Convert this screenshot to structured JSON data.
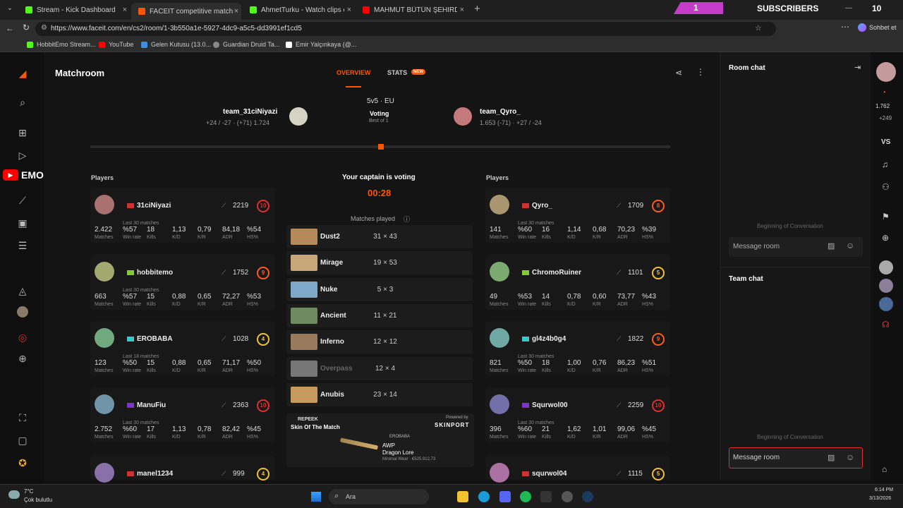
{
  "browser": {
    "tabs": [
      {
        "label": "Stream - Kick Dashboard",
        "color": "#53fc18"
      },
      {
        "label": "FACEIT competitive match - FACEIT",
        "color": "#ff5500"
      },
      {
        "label": "AhmetTurku - Watch clips on Kick",
        "color": "#53fc18"
      },
      {
        "label": "MAHMUT BÜTÜN ŞEHİRDE KAOS",
        "color": "#ff0000"
      }
    ],
    "url": "https://www.faceit.com/en/cs2/room/1-3b550a1e-5927-4dc9-a5c5-dd3991ef1cd5",
    "overlay_subscribers": "SUBSCRIBERS",
    "overlay_count": "1",
    "overlay_right": "10",
    "chat_button": "Sohbet et",
    "bookmarks": [
      "HobbitEmo Stream...",
      "YouTube",
      "Gelen Kutusu (13.0...",
      "Guardian Druid Ta...",
      "Emir Yalçınkaya (@..."
    ]
  },
  "header": {
    "title": "Matchroom",
    "tab_overview": "OVERVIEW",
    "tab_stats": "STATS",
    "tab_stats_badge": "NEW"
  },
  "match": {
    "team_left": "team_31ciNiyazi",
    "team_left_sub": "+24 / -27 · (+71) 1.724",
    "team_right": "team_Qyro_",
    "team_right_sub": "1.653 (-71) · +27 / -24",
    "mode": "5v5 · EU",
    "status": "Voting",
    "format": "Best of 1",
    "captain_msg": "Your captain is voting",
    "timer": "00:28",
    "matches_played": "Matches played",
    "players_label": "Players"
  },
  "stat_labels": [
    "Matches",
    "Win rate",
    "Kills",
    "K/D",
    "K/R",
    "ADR",
    "HS%"
  ],
  "left_players": [
    {
      "name": "31ciNiyazi",
      "elo": "2219",
      "level": "10",
      "lvlcolor": "#e03030",
      "last": "Last 30 matches",
      "stats": [
        "2.422",
        "%57",
        "18",
        "1,13",
        "0,79",
        "84,18",
        "%54"
      ]
    },
    {
      "name": "hobbitemo",
      "elo": "1752",
      "level": "9",
      "lvlcolor": "#ff5a1f",
      "last": "Last 30 matches",
      "stats": [
        "663",
        "%57",
        "15",
        "0,88",
        "0,65",
        "72,27",
        "%53"
      ]
    },
    {
      "name": "EROBABA",
      "elo": "1028",
      "level": "4",
      "lvlcolor": "#f2c230",
      "last": "Last 18 matches",
      "stats": [
        "123",
        "%50",
        "15",
        "0,88",
        "0,65",
        "71,17",
        "%50"
      ]
    },
    {
      "name": "ManuFiu",
      "elo": "2363",
      "level": "10",
      "lvlcolor": "#e03030",
      "last": "Last 30 matches",
      "stats": [
        "2.752",
        "%60",
        "17",
        "1,13",
        "0,78",
        "82,42",
        "%45"
      ]
    },
    {
      "name": "manel1234",
      "elo": "999",
      "level": "4",
      "lvlcolor": "#f2c230"
    }
  ],
  "right_players": [
    {
      "name": "Qyro_",
      "elo": "1709",
      "level": "8",
      "lvlcolor": "#ff5a1f",
      "last": "Last 30 matches",
      "stats": [
        "141",
        "%60",
        "16",
        "1,14",
        "0,68",
        "70,23",
        "%39"
      ]
    },
    {
      "name": "ChromoRuiner",
      "elo": "1101",
      "level": "5",
      "lvlcolor": "#f2c230",
      "last": "",
      "stats": [
        "49",
        "%53",
        "14",
        "0,78",
        "0,60",
        "73,77",
        "%43"
      ]
    },
    {
      "name": "gl4z4b0g4",
      "elo": "1822",
      "level": "9",
      "lvlcolor": "#ff5a1f",
      "last": "Last 30 matches",
      "stats": [
        "821",
        "%50",
        "18",
        "1,00",
        "0,76",
        "86,23",
        "%51"
      ]
    },
    {
      "name": "Squrwol00",
      "elo": "2259",
      "level": "10",
      "lvlcolor": "#e03030",
      "last": "Last 30 matches",
      "stats": [
        "396",
        "%60",
        "21",
        "1,62",
        "1,01",
        "99,06",
        "%45"
      ]
    },
    {
      "name": "squrwol04",
      "elo": "1115",
      "level": "5",
      "lvlcolor": "#f2c230"
    }
  ],
  "maps": [
    {
      "name": "Dust2",
      "score": "31 × 43",
      "color": "#b58a5a"
    },
    {
      "name": "Mirage",
      "score": "19 × 53",
      "color": "#c8a878"
    },
    {
      "name": "Nuke",
      "score": "5 × 3",
      "color": "#7fa7c9"
    },
    {
      "name": "Ancient",
      "score": "11 × 21",
      "color": "#6f8a5e"
    },
    {
      "name": "Inferno",
      "score": "12 × 12",
      "color": "#9a7a5c"
    },
    {
      "name": "Overpass",
      "score": "12 × 4",
      "color": "#777777"
    },
    {
      "name": "Anubis",
      "score": "23 × 14",
      "color": "#c79a5e"
    }
  ],
  "promo": {
    "brand": "REPEEK",
    "title": "Skin Of The Match",
    "powered": "Powered by",
    "sponsor": "SKINPORT",
    "player": "EROBABA",
    "weapon": "AWP",
    "skin": "Dragon Lore",
    "wear": "Minimal Wear · €525.912,73"
  },
  "chat": {
    "room_title": "Room chat",
    "begin": "Beginning of Conversation",
    "placeholder": "Message room",
    "team_title": "Team chat"
  },
  "rightrail": {
    "elo": "1.762",
    "delta": "+249",
    "vs": "VS"
  },
  "taskbar": {
    "weather_temp": "7°C",
    "weather_desc": "Çok bulutlu",
    "search": "Ara",
    "time": "6:14 PM",
    "date": "3/13/2026"
  },
  "side_overlay": "EMO"
}
